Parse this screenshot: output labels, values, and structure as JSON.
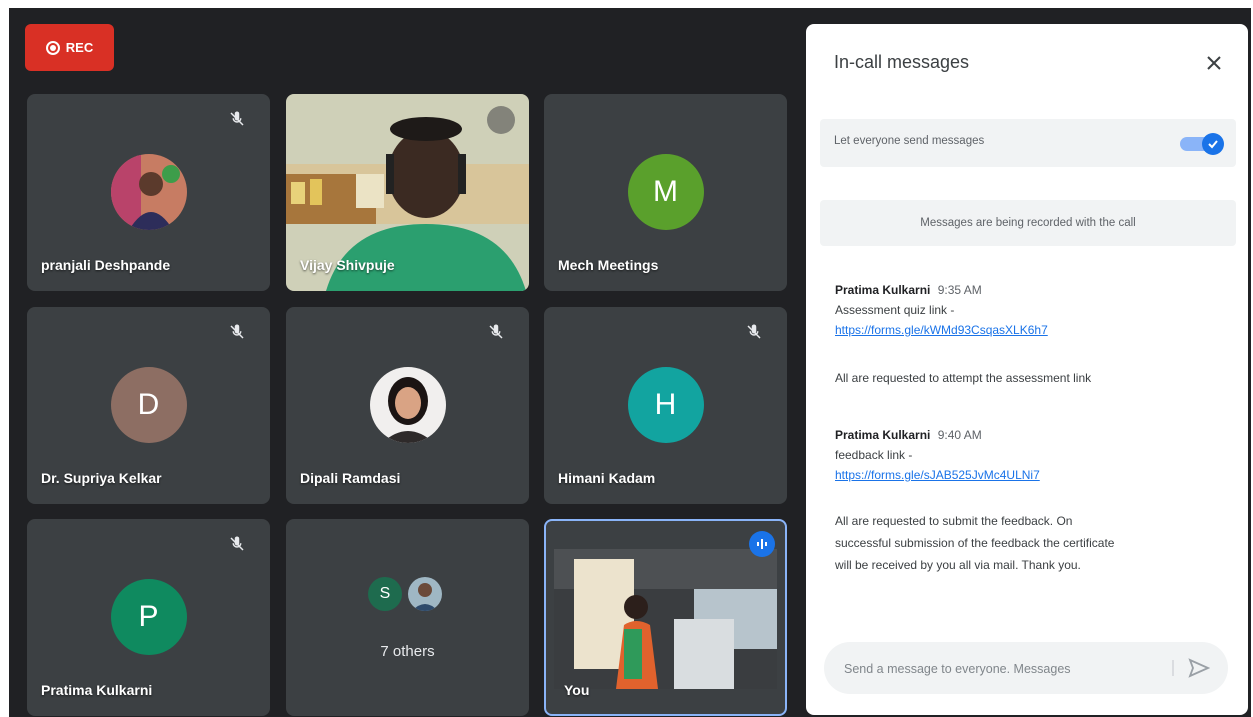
{
  "recording": {
    "label": "REC"
  },
  "participants": [
    {
      "name": "pranjali Deshpande",
      "muted": true
    },
    {
      "name": "Vijay Shivpuje",
      "muted": false
    },
    {
      "name": "Mech Meetings",
      "initial": "M",
      "color": "#5aa02c",
      "muted": false
    },
    {
      "name": "Dr. Supriya Kelkar",
      "initial": "D",
      "color": "#8d6e63",
      "muted": true
    },
    {
      "name": "Dipali Ramdasi",
      "muted": true
    },
    {
      "name": "Himani Kadam",
      "initial": "H",
      "color": "#12a4a0",
      "muted": true
    },
    {
      "name": "Pratima Kulkarni",
      "initial": "P",
      "color": "#0f8a5f",
      "muted": true
    },
    {
      "name": "You",
      "speaking": true
    }
  ],
  "others": {
    "initial": "S",
    "initial_color": "#1e6b4e",
    "label": "7 others"
  },
  "chat": {
    "title": "In-call messages",
    "toggle_label": "Let everyone send messages",
    "toggle_on": true,
    "notice": "Messages are being recorded with the call",
    "messages": [
      {
        "sender": "Pratima Kulkarni",
        "time": "9:35 AM",
        "text": "Assessment quiz link -",
        "link": "https://forms.gle/kWMd93CsqasXLK6h7",
        "follow": "All are requested to attempt the assessment link"
      },
      {
        "sender": "Pratima Kulkarni",
        "time": "9:40 AM",
        "text": "feedback link -",
        "link": "https://forms.gle/sJAB525JvMc4ULNi7",
        "follow_lines": [
          "All are requested to submit the feedback. On",
          "successful submission of the feedback the certificate",
          "will be received by you all via mail. Thank you."
        ]
      }
    ],
    "input_placeholder": "Send a message to everyone. Messages"
  }
}
